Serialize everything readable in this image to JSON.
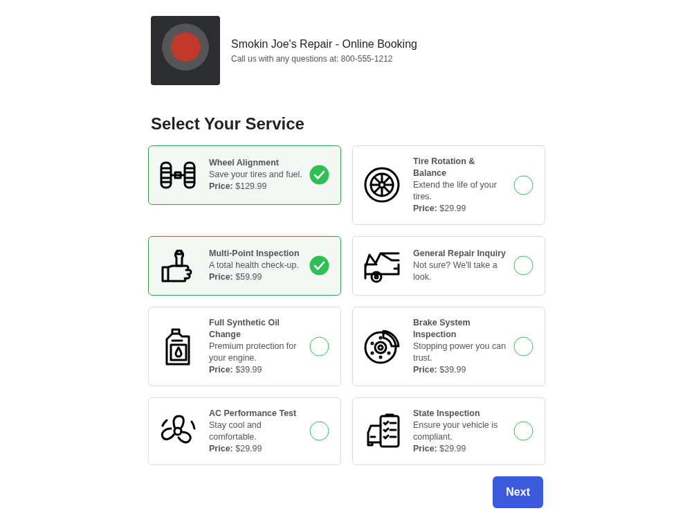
{
  "header": {
    "title": "Smokin Joe's Repair - Online Booking",
    "subtitle": "Call us with any questions at: 800-555-1212"
  },
  "heading": "Select Your Service",
  "services": [
    {
      "name": "Wheel Alignment",
      "description": "Save your tires and fuel.",
      "price": "**Price:** $129.99",
      "selected": true
    },
    {
      "name": "Tire Rotation & Balance",
      "description": "Extend the life of your tires.",
      "price": "**Price:** $29.99",
      "selected": false
    },
    {
      "name": "Multi-Point Inspection",
      "description": "A total health check-up.",
      "price": "**Price:** $59.99",
      "selected": true
    },
    {
      "name": "General Repair Inquiry",
      "description": "Not sure? We'll take a look.",
      "selected": false
    },
    {
      "name": "Full Synthetic Oil Change",
      "description": "Premium protection for your engine.",
      "price": "**Price:** $39.99",
      "selected": false
    },
    {
      "name": "Brake System Inspection",
      "description": "Stopping power you can trust.",
      "price": "**Price:** $39.99",
      "selected": false
    },
    {
      "name": "AC Performance Test",
      "description": "Stay cool and comfortable.",
      "price": "**Price:** $29.99",
      "selected": false
    },
    {
      "name": "State Inspection",
      "description": "Ensure your vehicle is compliant.",
      "price": "**Price:** $29.99",
      "selected": false
    }
  ],
  "next_button": "Next"
}
